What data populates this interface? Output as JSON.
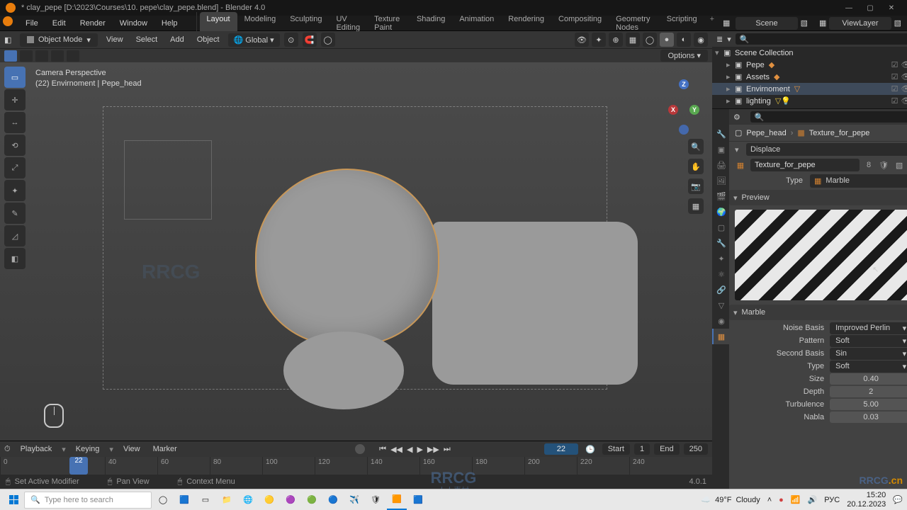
{
  "titlebar": {
    "title": "* clay_pepe [D:\\2023\\Courses\\10. pepe\\clay_pepe.blend] - Blender 4.0"
  },
  "menubar": {
    "items": [
      "File",
      "Edit",
      "Render",
      "Window",
      "Help"
    ],
    "workspaces": [
      "Layout",
      "Modeling",
      "Sculpting",
      "UV Editing",
      "Texture Paint",
      "Shading",
      "Animation",
      "Rendering",
      "Compositing",
      "Geometry Nodes",
      "Scripting"
    ],
    "active_workspace": "Layout",
    "scene": "Scene",
    "viewlayer": "ViewLayer"
  },
  "view_header": {
    "mode": "Object Mode",
    "menus": [
      "View",
      "Select",
      "Add",
      "Object"
    ],
    "orientation": "Global",
    "options": "Options"
  },
  "viewport": {
    "line1": "Camera Perspective",
    "line2": "(22) Envirnoment | Pepe_head"
  },
  "outliner": {
    "root": "Scene Collection",
    "items": [
      {
        "name": "Pepe",
        "type": "collection"
      },
      {
        "name": "Assets",
        "type": "collection"
      },
      {
        "name": "Envirnoment",
        "type": "mesh"
      },
      {
        "name": "lighting",
        "type": "mesh"
      }
    ]
  },
  "props": {
    "breadcrumb": {
      "object": "Pepe_head",
      "texture": "Texture_for_pepe"
    },
    "modifier": "Displace",
    "texture": {
      "name": "Texture_for_pepe",
      "users": "8"
    },
    "type_label": "Type",
    "type_value": "Marble",
    "preview_label": "Preview",
    "marble_label": "Marble",
    "params": {
      "noise_basis_label": "Noise Basis",
      "noise_basis": "Improved Perlin",
      "pattern_label": "Pattern",
      "pattern": "Soft",
      "second_basis_label": "Second Basis",
      "second_basis": "Sin",
      "type2_label": "Type",
      "type2": "Soft",
      "size_label": "Size",
      "size": "0.40",
      "depth_label": "Depth",
      "depth": "2",
      "turbulence_label": "Turbulence",
      "turbulence": "5.00",
      "nabla_label": "Nabla",
      "nabla": "0.03"
    }
  },
  "timeline": {
    "menus": [
      "Playback",
      "Keying",
      "View",
      "Marker"
    ],
    "current": "22",
    "start_label": "Start",
    "start": "1",
    "end_label": "End",
    "end": "250",
    "ticks": [
      "0",
      "22",
      "40",
      "60",
      "80",
      "100",
      "120",
      "140",
      "160",
      "180",
      "200",
      "220",
      "240"
    ]
  },
  "statusbar": {
    "left": "Set Active Modifier",
    "mid1": "Pan View",
    "mid2": "Context Menu",
    "version": "4.0.1"
  },
  "taskbar": {
    "search_placeholder": "Type here to search",
    "weather_temp": "49°F",
    "weather_cond": "Cloudy",
    "time": "15:20",
    "date": "20.12.2023"
  },
  "watermark": {
    "site": "RRCG",
    "sub": "人人素材"
  }
}
